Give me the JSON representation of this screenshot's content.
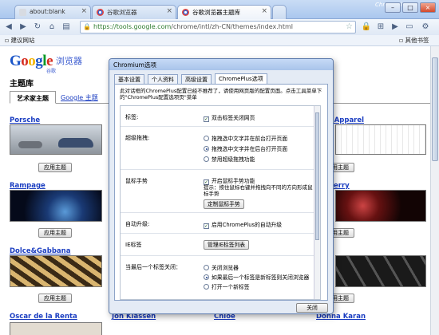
{
  "browser": {
    "tabs": [
      {
        "title": "about:blank"
      },
      {
        "title": "谷歌浏览器"
      },
      {
        "title": "谷歌浏览器主题库"
      }
    ],
    "brand": "ChromePlus",
    "url": {
      "scheme": "https://",
      "host": "tools.google.com",
      "path": "/chrome/intl/zh-CN/themes/index.html"
    },
    "bookmarks": {
      "left": "建议网站",
      "right": "其他书签"
    }
  },
  "page": {
    "logo_text": {
      "g": "G",
      "o1": "o",
      "o2": "o",
      "g2": "g",
      "l": "l",
      "e": "e"
    },
    "logo_subtitle": "浏览器",
    "logo_subtitle2": "谷歌",
    "title": "主题库",
    "tabs": [
      {
        "label": "艺术家主题"
      },
      {
        "label": "Google 主题"
      }
    ],
    "themes": [
      {
        "name": "Porsche"
      },
      {
        "name": "Rampage"
      },
      {
        "name": "Dolce&Gabbana"
      },
      {
        "name": "Oscar de la Renta"
      },
      {
        "name": "ican Apparel"
      },
      {
        "name": "erry"
      },
      {
        "name": "Jon Klassen"
      },
      {
        "name": "Chloé"
      },
      {
        "name": "Donna Karan"
      }
    ],
    "apply_label": "应用主题"
  },
  "dialog": {
    "title": "Chromium选项",
    "tabs": [
      {
        "label": "基本设置"
      },
      {
        "label": "个人资料"
      },
      {
        "label": "高级设置"
      },
      {
        "label": "ChromePlus选项"
      }
    ],
    "note": "此对话框的ChromePlus配置已经不推荐了，请使用网页版的配置页面。点击工具菜单下的\"ChromePlus配置选项页\"菜单",
    "sections": {
      "tab": {
        "label": "标签:",
        "opt": "双击标签关闭网页"
      },
      "drag": {
        "label": "超级拖拽:",
        "opts": [
          "拖拽选中文字并在前台打开页面",
          "拖拽选中文字并在后台打开页面",
          "禁用超级拖拽功能"
        ]
      },
      "mouse": {
        "label": "鼠标手势",
        "opt": "开启鼠标手势功能",
        "hint": "提示：按住鼠标右键并拖拽向不同的方向形成鼠标手势",
        "button": "定制鼠标手势"
      },
      "upgrade": {
        "label": "自动升级:",
        "opt": "启用ChromePlus的自动升级"
      },
      "ie": {
        "label": "IE标签",
        "button": "管理IE标签列表"
      },
      "lasttab": {
        "label": "当最后一个标签关闭：",
        "opts": [
          "关闭浏览器",
          "如果最后一个标签是新标签则关闭浏览器",
          "打开一个新标签"
        ]
      }
    },
    "close_button": "关闭"
  }
}
